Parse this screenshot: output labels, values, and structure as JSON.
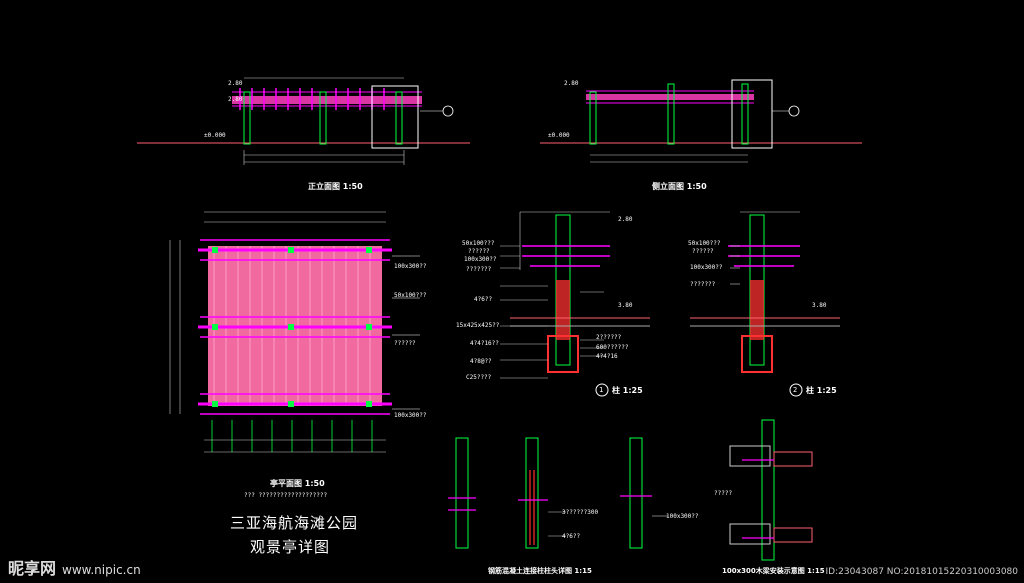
{
  "drawing": {
    "front_elevation_caption": "正立面图 1:50",
    "side_elevation_caption": "侧立面图 1:50",
    "plan_caption": "亭平面图 1:50",
    "plan_subcaption": "??? ???????????????????",
    "detail1_caption": "柱 1:25",
    "detail2_caption": "柱 1:25",
    "detail1_num": "1",
    "detail2_num": "2",
    "bottom_detail_caption": "钢筋混凝土连接柱柱头详图 1:15",
    "bottom_right_caption": "100x300木梁安装示意图 1:15",
    "project_title": "三亚海航海滩公园",
    "drawing_title": "观景亭详图",
    "annotations": {
      "a1": "100x300??",
      "a2": "50x100???",
      "a3": "??????",
      "a4": "100x300??",
      "a5": "50x100???",
      "a6": "??????",
      "a7": "100x300??",
      "a8": "???????",
      "a9": "4?6??",
      "a10": "15x425x425??",
      "a11": "4?4?16??",
      "a12": "4?8@??",
      "a13": "C25????",
      "a14": "2??????",
      "a15": "600??????",
      "a16": "4?4?16",
      "a17": "50x100???",
      "a18": "??????",
      "a19": "100x300??",
      "a20": "???????",
      "a21": "3??????300",
      "a22": "4?6??",
      "a23": "100x300??",
      "a24": "?????",
      "a25": "2.80",
      "a26": "2.80",
      "a27": "2.80",
      "a28": "±0.000",
      "a29": "±0.000",
      "a30": "2.80",
      "a31": "3.80",
      "a32": "3.80"
    }
  },
  "watermark": {
    "brand": "昵享网",
    "url": "www.nipic.cn",
    "id_text": "ID:23043087 NO:20181015220310003080"
  },
  "colors": {
    "pink_fill": "#f06aa0",
    "magenta": "#ff00ff",
    "green": "#00ff40",
    "white": "#ffffff",
    "red": "#ff3030",
    "line_pink": "#ff6070"
  }
}
